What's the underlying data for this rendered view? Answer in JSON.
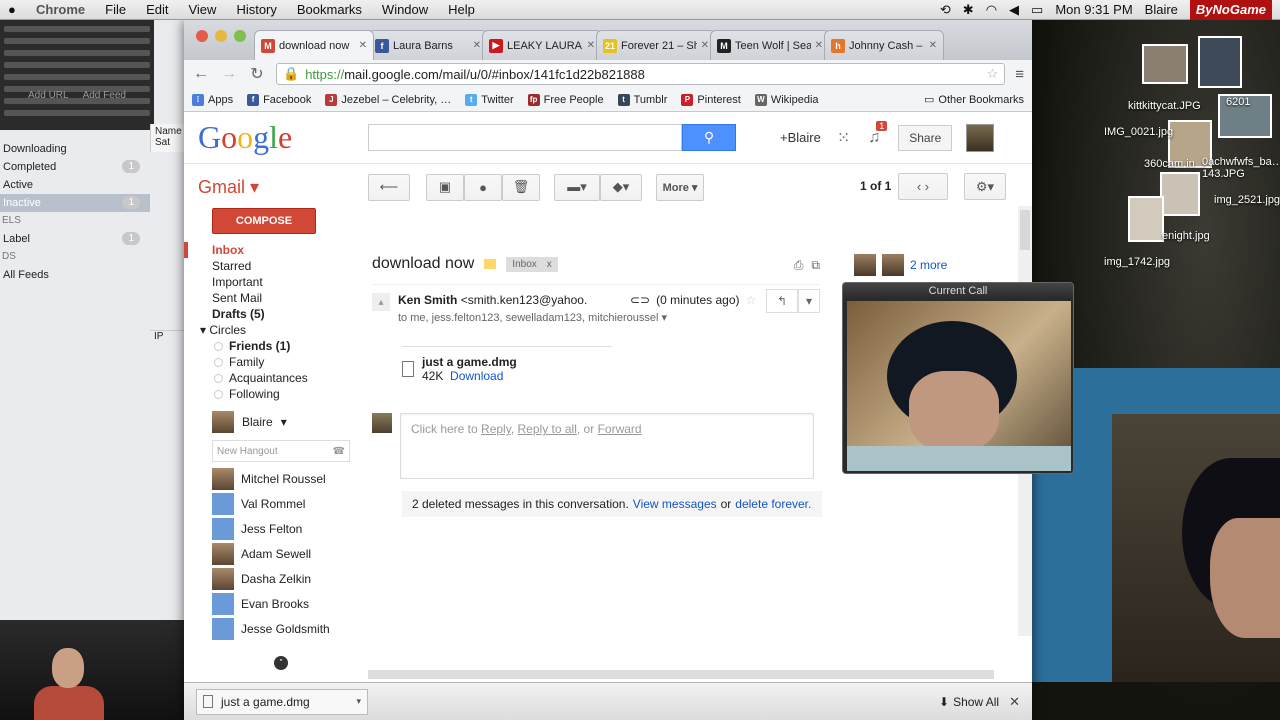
{
  "menubar": {
    "app": "Chrome",
    "items": [
      "File",
      "Edit",
      "View",
      "History",
      "Bookmarks",
      "Window",
      "Help"
    ],
    "clock": "Mon 9:31 PM",
    "user": "Blaire",
    "brand": "ByNoGame"
  },
  "bgapp": {
    "buttons": [
      "Add URL",
      "Add Feed"
    ],
    "column_header": "Name",
    "column_value": "Sat",
    "nav": [
      {
        "label": "Downloading",
        "count": ""
      },
      {
        "label": "Completed",
        "count": "1"
      },
      {
        "label": "Active",
        "count": ""
      },
      {
        "label": "Inactive",
        "count": "1"
      }
    ],
    "labels_section": "ELS",
    "label_item": {
      "label": "Label",
      "count": "1"
    },
    "feeds_section": "DS",
    "feeds_item": "All Feeds",
    "ip_label": "IP"
  },
  "browser": {
    "tabs": [
      {
        "title": "download now",
        "fav": "M",
        "color": "#d14836",
        "active": true
      },
      {
        "title": "Laura Barns",
        "fav": "f",
        "color": "#3b5998",
        "active": false
      },
      {
        "title": "LEAKY LAURA",
        "fav": "▶",
        "color": "#cc181e",
        "active": false
      },
      {
        "title": "Forever 21 – Sh",
        "fav": "21",
        "color": "#e6c21a",
        "active": false
      },
      {
        "title": "Teen Wolf | Sea",
        "fav": "M",
        "color": "#222222",
        "active": false
      },
      {
        "title": "Johnny Cash –",
        "fav": "h",
        "color": "#e5762a",
        "active": false
      }
    ],
    "url_https": "https://",
    "url_rest": "mail.google.com/mail/u/0/#inbox/141fc1d22b821888",
    "bookmarks": [
      {
        "label": "Apps",
        "color": "#4a7de0",
        "fav": "⁞"
      },
      {
        "label": "Facebook",
        "color": "#3b5998",
        "fav": "f"
      },
      {
        "label": "Jezebel – Celebrity, …",
        "color": "#b83a3a",
        "fav": "J"
      },
      {
        "label": "Twitter",
        "color": "#55acee",
        "fav": "t"
      },
      {
        "label": "Free People",
        "color": "#9b2c2c",
        "fav": "fp"
      },
      {
        "label": "Tumblr",
        "color": "#35465c",
        "fav": "t"
      },
      {
        "label": "Pinterest",
        "color": "#cb2027",
        "fav": "P"
      },
      {
        "label": "Wikipedia",
        "color": "#666666",
        "fav": "W"
      }
    ],
    "other_bookmarks": "Other Bookmarks"
  },
  "gmail": {
    "logo": [
      "G",
      "o",
      "o",
      "g",
      "l",
      "e"
    ],
    "plus_user": "+Blaire",
    "notif_count": "1",
    "share": "Share",
    "gmail_label": "Gmail ▾",
    "more": "More ▾",
    "pager": "1 of 1",
    "compose": "COMPOSE",
    "folders": [
      "Inbox",
      "Starred",
      "Important",
      "Sent Mail",
      "Drafts (5)"
    ],
    "circles_label": "Circles",
    "circles": [
      "Friends (1)",
      "Family",
      "Acquaintances",
      "Following"
    ],
    "me": "Blaire",
    "new_hangout": "New Hangout",
    "contacts": [
      "Mitchel Roussel",
      "Val Rommel",
      "Jess Felton",
      "Adam Sewell",
      "Dasha Zelkin",
      "Evan Brooks",
      "Jesse Goldsmith"
    ],
    "thread": {
      "subject": "download now",
      "chip": "Inbox",
      "sender_name": "Ken Smith",
      "sender_email": "<smith.ken123@yahoo.",
      "time": "(0 minutes ago)",
      "to": "to me, jess.felton123, sewelladam123, mitchieroussel",
      "attachment_name": "just a game.dmg",
      "attachment_size": "42K",
      "download": "Download",
      "reply_prefix": "Click here to",
      "reply": "Reply",
      "reply_all": "Reply to all",
      "or": ", or",
      "forward": "Forward",
      "deleted_text": "2 deleted messages in this conversation.",
      "view_messages": "View messages",
      "or2": "or",
      "delete_forever": "delete forever."
    },
    "people_more": "2 more"
  },
  "downloads_bar": {
    "file": "just a game.dmg",
    "show_all": "Show All"
  },
  "call": {
    "title": "Current Call"
  },
  "desktop": {
    "files": [
      "kittkittycat.JPG",
      "IMG_0021.jpg",
      "360cam.in…",
      "0achwfwfs_ba…143.JPG",
      "img_2521.jpg",
      "enight.jpg",
      "img_1742.jpg",
      "6201"
    ]
  }
}
